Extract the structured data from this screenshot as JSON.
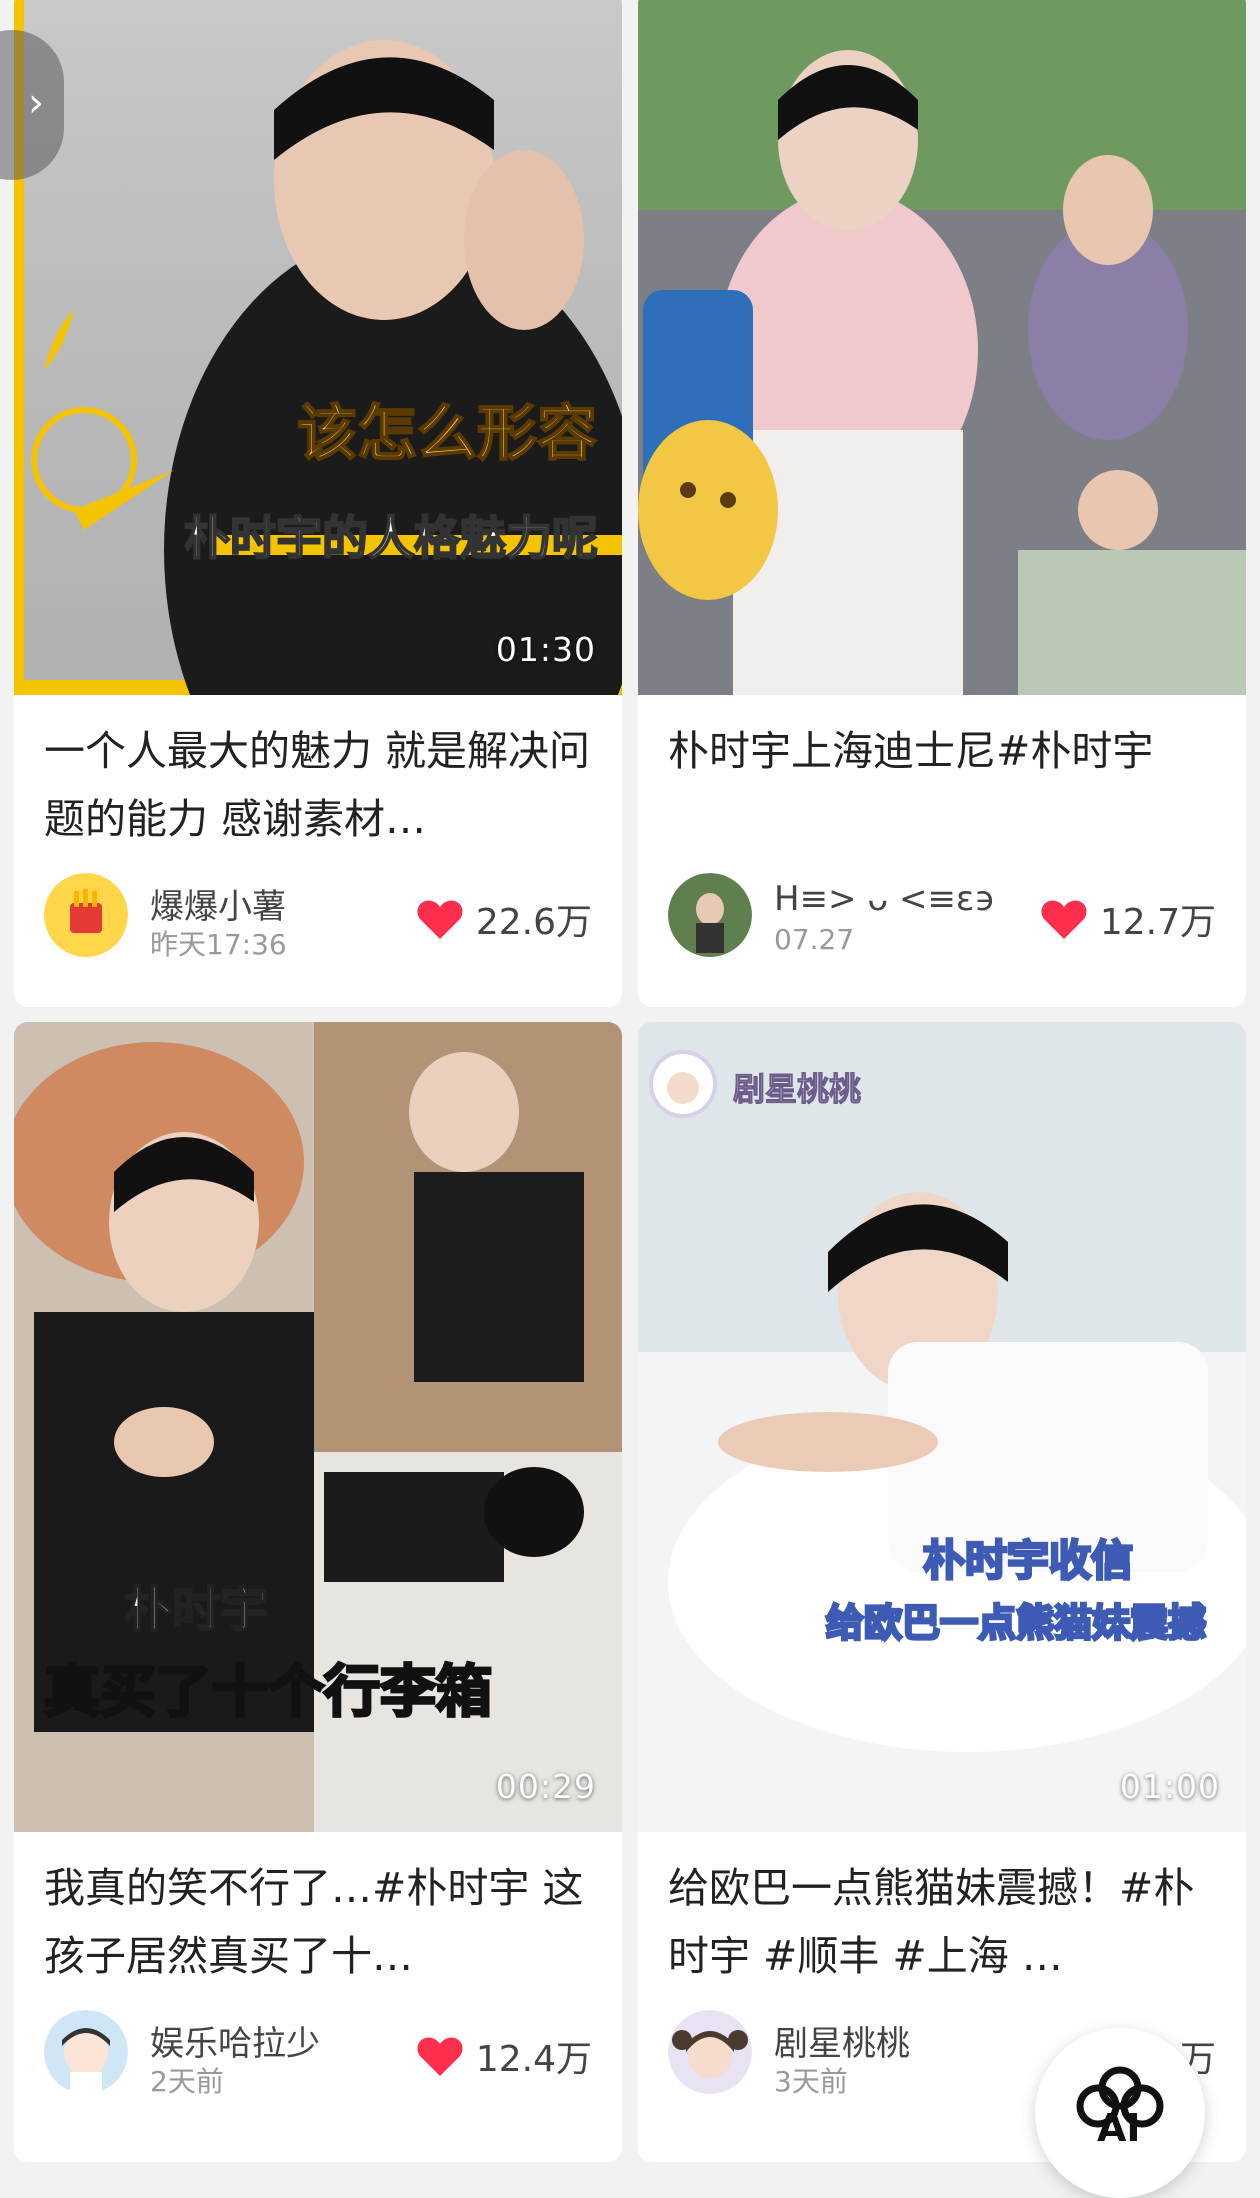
{
  "cards": [
    {
      "overlay_line1": "该怎么形容",
      "overlay_line2": "朴时宇的人格魅力呢",
      "duration": "01:30",
      "title": "一个人最大的魅力 就是解决问题的能力 感谢素材…",
      "author": "爆爆小薯",
      "time": "昨天17:36",
      "likes": "22.6万"
    },
    {
      "title": "朴时宇上海迪士尼#朴时宇",
      "author": "H≡> ᴗ <≡ɛ϶",
      "time": "07.27",
      "likes": "12.7万"
    },
    {
      "overlay_line1": "朴时宇",
      "overlay_line2": "真买了十个行李箱",
      "duration": "00:29",
      "title": "我真的笑不行了…#朴时宇 这孩子居然真买了十…",
      "author": "娱乐哈拉少",
      "time": "2天前",
      "likes": "12.4万"
    },
    {
      "watermark": "剧星桃桃",
      "overlay_line1": "朴时宇收信",
      "overlay_line2": "给欧巴一点熊猫妹震撼",
      "duration": "01:00",
      "title": "给欧巴一点熊猫妹震撼！#朴时宇 #顺丰 #上海 …",
      "author": "剧星桃桃",
      "time": "3天前",
      "likes": "万"
    }
  ],
  "fab": {
    "label": "AI"
  },
  "side_handle": {
    "glyph": "›"
  },
  "colors": {
    "heart": "#ff2e4d",
    "title_text": "#222222",
    "meta_text": "#999999"
  }
}
